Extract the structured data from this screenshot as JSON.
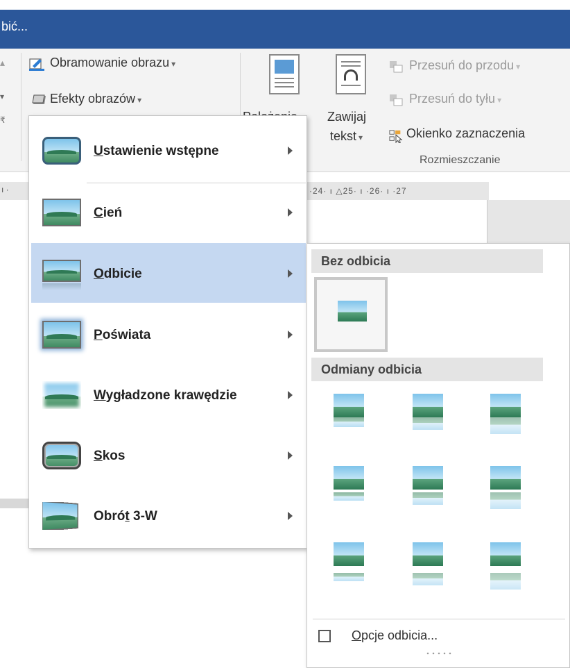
{
  "window": {
    "title": "bić..."
  },
  "ribbon": {
    "picture_border": "Obramowanie obrazu",
    "picture_effects": "Efekty obrazów",
    "position_btn": "Położenie",
    "wrap_text": [
      "Zawijaj",
      "tekst"
    ],
    "bring_forward": "Przesuń do przodu",
    "send_backward": "Przesuń do tyłu",
    "selection_pane": "Okienko zaznaczenia",
    "group_label": "Rozmieszczanie"
  },
  "ruler": {
    "text": "·24· ı △25· ı ·26· ı ·27",
    "left_mark": "ı ·"
  },
  "effects_menu": {
    "items": [
      {
        "prefix": "",
        "accel": "U",
        "rest": "stawienie wstępne",
        "active": false
      },
      {
        "prefix": "",
        "accel": "C",
        "rest": "ień",
        "active": false
      },
      {
        "prefix": "",
        "accel": "O",
        "rest": "dbicie",
        "active": true
      },
      {
        "prefix": "",
        "accel": "P",
        "rest": "oświata",
        "active": false
      },
      {
        "prefix": "",
        "accel": "W",
        "rest": "ygładzone krawędzie",
        "active": false
      },
      {
        "prefix": "",
        "accel": "S",
        "rest": "kos",
        "active": false
      },
      {
        "prefix": "Obró",
        "accel": "t",
        "rest": " 3-W",
        "active": false
      }
    ]
  },
  "reflection_submenu": {
    "no_reflection_heading": "Bez odbicia",
    "variations_heading": "Odmiany odbicia",
    "options_accel": "O",
    "options_rest": "pcje odbicia..."
  },
  "colors": {
    "title_bar": "#2b579a",
    "ribbon": "#f3f3f3",
    "menu_highlight": "#c5d8f1"
  }
}
